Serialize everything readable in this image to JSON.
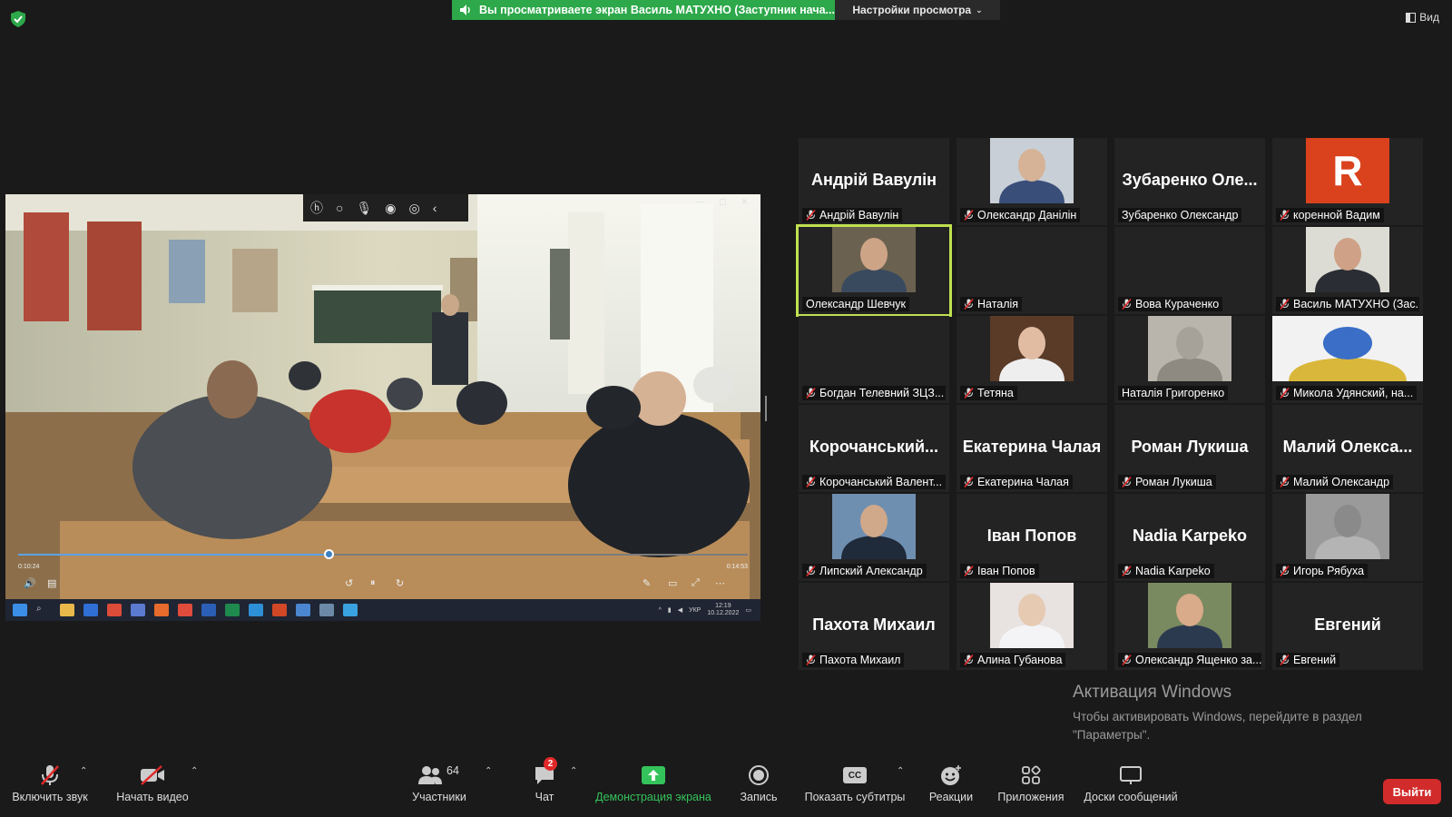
{
  "banner": {
    "text": "Вы просматриваете экран Василь МАТУХНО (Заступник нача...",
    "view_settings": "Настройки просмотра",
    "view_button": "Вид"
  },
  "shared_screen": {
    "progress": 0.425,
    "time_current": "0:10:24",
    "time_total": "0:14:53",
    "clock_time": "12:19",
    "clock_date": "10.12.2022",
    "lang": "УКР"
  },
  "participants": [
    {
      "big_name": "Андрій Вавулін",
      "label": "Андрій Вавулін",
      "muted": true,
      "media": "name"
    },
    {
      "big_name": "",
      "label": "Олександр Данілін",
      "muted": true,
      "media": "photo",
      "photo": "uniform"
    },
    {
      "big_name": "Зубаренко Оле...",
      "label": "Зубаренко Олександр",
      "muted": false,
      "media": "name"
    },
    {
      "big_name": "R",
      "label": "коренной Вадим",
      "muted": true,
      "media": "avatar",
      "avatar_color": "#d9421c"
    },
    {
      "big_name": "",
      "label": "Олександр Шевчук",
      "muted": false,
      "media": "photo",
      "photo": "man-room",
      "active": true
    },
    {
      "big_name": "",
      "label": "Наталія",
      "muted": true,
      "media": "none"
    },
    {
      "big_name": "",
      "label": "Вова Кураченко",
      "muted": true,
      "media": "none"
    },
    {
      "big_name": "",
      "label": "Василь МАТУХНО (Зас...",
      "muted": true,
      "media": "photo",
      "photo": "man-office"
    },
    {
      "big_name": "",
      "label": "Богдан Телевний ЗЦЗ...",
      "muted": true,
      "media": "none"
    },
    {
      "big_name": "",
      "label": "Тетяна",
      "muted": true,
      "media": "photo",
      "photo": "woman"
    },
    {
      "big_name": "",
      "label": "Наталія Григоренко",
      "muted": false,
      "media": "photo",
      "photo": "wall"
    },
    {
      "big_name": "",
      "label": "Микола Удянский, на...",
      "muted": true,
      "media": "photo",
      "photo": "emblem"
    },
    {
      "big_name": "Корочанський...",
      "label": "Корочанський Валент...",
      "muted": true,
      "media": "name"
    },
    {
      "big_name": "Екатерина Чалая",
      "label": "Екатерина Чалая",
      "muted": true,
      "media": "name"
    },
    {
      "big_name": "Роман Лукиша",
      "label": "Роман Лукиша",
      "muted": true,
      "media": "name"
    },
    {
      "big_name": "Малий Олекса...",
      "label": "Малий Олександр",
      "muted": true,
      "media": "name"
    },
    {
      "big_name": "",
      "label": "Липский Александр",
      "muted": true,
      "media": "photo",
      "photo": "man-outdoor"
    },
    {
      "big_name": "Іван Попов",
      "label": "Іван Попов",
      "muted": true,
      "media": "name"
    },
    {
      "big_name": "Nadia Karpeko",
      "label": "Nadia Karpeko",
      "muted": true,
      "media": "name"
    },
    {
      "big_name": "",
      "label": "Игорь Рябуха",
      "muted": true,
      "media": "photo",
      "photo": "blur"
    },
    {
      "big_name": "Пахота Михаил",
      "label": "Пахота Михаил",
      "muted": true,
      "media": "name"
    },
    {
      "big_name": "",
      "label": "Алина Губанова",
      "muted": true,
      "media": "photo",
      "photo": "woman-blonde"
    },
    {
      "big_name": "",
      "label": "Олександр Ященко за...",
      "muted": true,
      "media": "photo",
      "photo": "man-smile"
    },
    {
      "big_name": "Евгений",
      "label": "Евгений",
      "muted": true,
      "media": "name"
    }
  ],
  "watermark": {
    "title": "Активация Windows",
    "body": "Чтобы активировать Windows, перейдите в раздел \"Параметры\"."
  },
  "toolbar": {
    "unmute": "Включить звук",
    "start_video": "Начать видео",
    "participants": "Участники",
    "participants_count": "64",
    "chat": "Чат",
    "chat_badge": "2",
    "share_screen": "Демонстрация экрана",
    "record": "Запись",
    "captions": "Показать субтитры",
    "captions_icon": "CC",
    "reactions": "Реакции",
    "apps": "Приложения",
    "whiteboards": "Доски сообщений",
    "leave": "Выйти"
  },
  "colors": {
    "banner_green": "#2da84a",
    "active_speaker": "#bfe050",
    "leave_red": "#d12b2b",
    "share_green": "#34c35a"
  }
}
